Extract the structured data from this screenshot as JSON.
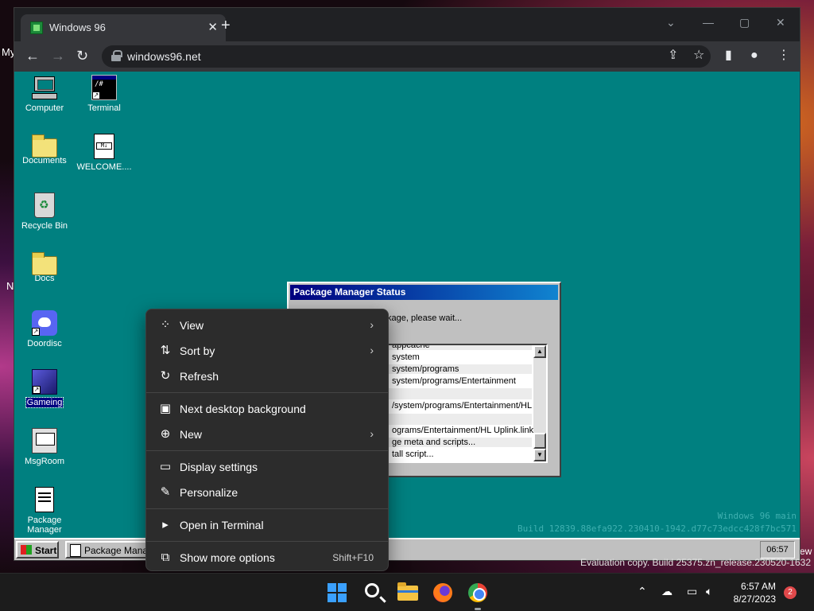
{
  "host_fragments": {
    "left_top": "My",
    "left_mid": "N",
    "right_mid": "ew"
  },
  "browser": {
    "tab_title": "Windows 96",
    "tab_close": "✕",
    "new_tab": "+",
    "url": "windows96.net",
    "window_controls": {
      "dropdown": "⌄",
      "minimize": "—",
      "maximize": "▢",
      "close": "✕"
    }
  },
  "desktop": {
    "icons": [
      {
        "label": "Computer",
        "icon": "computer-icon"
      },
      {
        "label": "Terminal",
        "icon": "terminal-icon"
      },
      {
        "label": "Documents",
        "icon": "documents-folder-icon"
      },
      {
        "label": "WELCOME....",
        "icon": "markdown-file-icon"
      },
      {
        "label": "Recycle Bin",
        "icon": "recycle-bin-icon"
      },
      {
        "label": "Docs",
        "icon": "folder-icon"
      },
      {
        "label": "Doordisc",
        "icon": "discord-icon"
      },
      {
        "label": "Gameing",
        "icon": "game-icon",
        "selected": true
      },
      {
        "label": "MsgRoom",
        "icon": "msgroom-icon"
      },
      {
        "label": "Package Manager",
        "icon": "package-manager-icon"
      }
    ],
    "terminal_prompt": "/#",
    "doc_tag": "M↓",
    "build_line1": "Windows 96 main",
    "build_line2": "Build 12839.88efa922.230410-1942.d77c73edcc428f7bc571"
  },
  "package_dialog": {
    "title": "Package Manager Status",
    "status": "kage, please wait...",
    "log_lines": [
      "appcache",
      "system",
      "system/programs",
      "system/programs/Entertainment",
      "",
      "/system/programs/Entertainment/HL",
      "",
      "ograms/Entertainment/HL Uplink.link",
      "ge meta and scripts...",
      "tall script..."
    ]
  },
  "w96_taskbar": {
    "start_label": "Start",
    "task_label": "Package Manag",
    "clock": "06:57"
  },
  "context_menu": {
    "items": [
      {
        "label": "View",
        "icon": "grid-view-icon",
        "submenu": true
      },
      {
        "label": "Sort by",
        "icon": "sort-icon",
        "submenu": true
      },
      {
        "label": "Refresh",
        "icon": "refresh-icon"
      },
      {
        "label": "Next desktop background",
        "icon": "next-background-icon"
      },
      {
        "label": "New",
        "icon": "new-plus-icon",
        "submenu": true
      },
      {
        "label": "Display settings",
        "icon": "display-settings-icon"
      },
      {
        "label": "Personalize",
        "icon": "personalize-brush-icon"
      },
      {
        "label": "Open in Terminal",
        "icon": "terminal-icon"
      },
      {
        "label": "Show more options",
        "icon": "more-options-icon",
        "shortcut": "Shift+F10"
      }
    ]
  },
  "watermark": "Evaluation copy. Build 25375.zn_release.230520-1632",
  "taskbar": {
    "apps": [
      "windows-start-icon",
      "search-icon",
      "file-explorer-icon",
      "firefox-icon",
      "chrome-icon"
    ],
    "time": "6:57 AM",
    "date": "8/27/2023",
    "notifications": "2"
  }
}
